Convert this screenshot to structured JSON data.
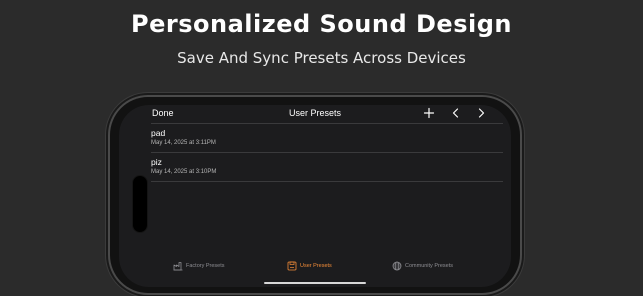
{
  "hero": {
    "title": "Personalized Sound Design",
    "subtitle": "Save And Sync Presets Across Devices"
  },
  "navbar": {
    "done_label": "Done",
    "title": "User Presets",
    "add_icon": "plus-icon",
    "back_icon": "chevron-left-icon",
    "forward_icon": "chevron-right-icon"
  },
  "presets": [
    {
      "name": "pad",
      "date": "May 14, 2025 at 3:11PM"
    },
    {
      "name": "piz",
      "date": "May 14, 2025 at 3:10PM"
    }
  ],
  "tabbar": {
    "tabs": [
      {
        "label": "Factory Presets",
        "icon": "factory-icon",
        "active": false
      },
      {
        "label": "User Presets",
        "icon": "user-presets-icon",
        "active": true
      },
      {
        "label": "Community Presets",
        "icon": "globe-icon",
        "active": false
      }
    ]
  },
  "colors": {
    "accent": "#f28c38",
    "background": "#2b2b2b",
    "screen": "#1c1c1e",
    "separator": "#3a3a3c",
    "inactive_tab": "#8e8e93"
  }
}
